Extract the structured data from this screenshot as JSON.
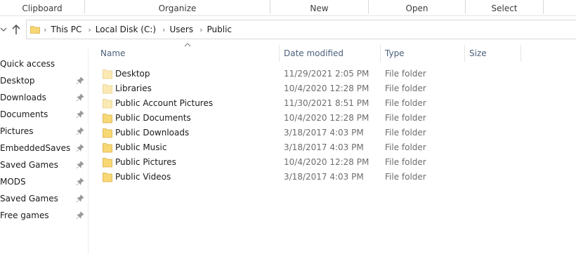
{
  "ribbon": {
    "groups": [
      "Clipboard",
      "Organize",
      "New",
      "Open",
      "Select"
    ]
  },
  "address": {
    "crumbs": [
      "This PC",
      "Local Disk (C:)",
      "Users",
      "Public"
    ]
  },
  "nav": {
    "items": [
      {
        "label": "Quick access",
        "pinned": false
      },
      {
        "label": "Desktop",
        "pinned": true
      },
      {
        "label": "Downloads",
        "pinned": true
      },
      {
        "label": "Documents",
        "pinned": true
      },
      {
        "label": "Pictures",
        "pinned": true
      },
      {
        "label": "EmbeddedSaves",
        "pinned": true
      },
      {
        "label": "Saved Games",
        "pinned": true
      },
      {
        "label": "MODS",
        "pinned": true
      },
      {
        "label": "Saved Games",
        "pinned": true
      },
      {
        "label": "Free games",
        "pinned": true
      }
    ]
  },
  "list": {
    "columns": {
      "name": "Name",
      "date": "Date modified",
      "type": "Type",
      "size": "Size"
    },
    "rows": [
      {
        "name": "Desktop",
        "date": "11/29/2021 2:05 PM",
        "type": "File folder",
        "icon": "folder-light-icon"
      },
      {
        "name": "Libraries",
        "date": "10/4/2020 12:28 PM",
        "type": "File folder",
        "icon": "folder-light-icon"
      },
      {
        "name": "Public Account Pictures",
        "date": "11/30/2021 8:51 PM",
        "type": "File folder",
        "icon": "folder-light-icon"
      },
      {
        "name": "Public Documents",
        "date": "10/4/2020 12:28 PM",
        "type": "File folder",
        "icon": "folder-icon"
      },
      {
        "name": "Public Downloads",
        "date": "3/18/2017 4:03 PM",
        "type": "File folder",
        "icon": "folder-icon"
      },
      {
        "name": "Public Music",
        "date": "3/18/2017 4:03 PM",
        "type": "File folder",
        "icon": "folder-icon"
      },
      {
        "name": "Public Pictures",
        "date": "10/4/2020 12:28 PM",
        "type": "File folder",
        "icon": "folder-icon"
      },
      {
        "name": "Public Videos",
        "date": "3/18/2017 4:03 PM",
        "type": "File folder",
        "icon": "folder-icon"
      }
    ]
  },
  "colors": {
    "folder": "#f8d775",
    "folder_light": "#fbe9b4",
    "header_text": "#4c607a"
  }
}
